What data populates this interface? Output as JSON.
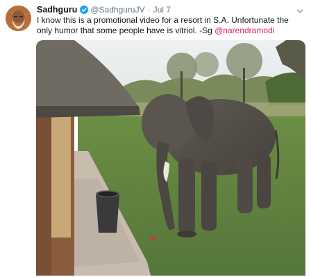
{
  "tweet": {
    "author_name": "Sadhguru",
    "handle": "@SadhguruJV",
    "separator": "·",
    "timestamp": "Jul 7",
    "text_prefix": "I know this is a  promotional video for a resort in S.A. Unfortunate the only humor that some people have is vitriol. -Sg ",
    "mention": "@narendramodi",
    "avatar_icon": "profile-avatar",
    "verified_icon": "verified-badge-icon",
    "menu_icon": "chevron-down-icon",
    "media_description_icon": "video-thumbnail",
    "colors": {
      "mention": "#e0245e",
      "verified": "#1da1f2",
      "secondary_text": "#657786"
    }
  }
}
